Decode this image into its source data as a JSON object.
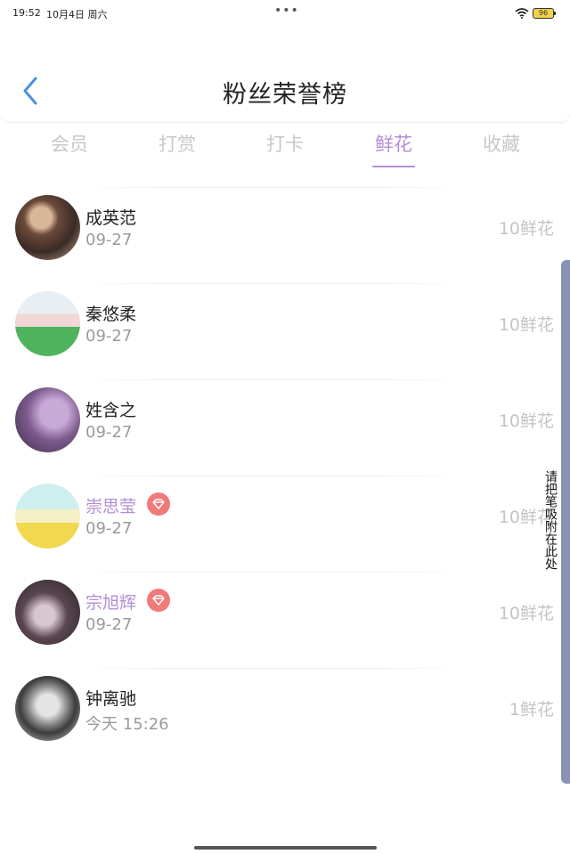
{
  "status_bar": {
    "time": "19:52",
    "date": "10月4日 周六",
    "dots": "•••",
    "battery": "96"
  },
  "header": {
    "title": "粉丝荣誉榜",
    "back_icon": "chevron-left-icon",
    "accent_color": "#4a90e2"
  },
  "tabs": [
    {
      "label": "会员",
      "active": false
    },
    {
      "label": "打赏",
      "active": false
    },
    {
      "label": "打卡",
      "active": false
    },
    {
      "label": "鲜花",
      "active": true
    },
    {
      "label": "收藏",
      "active": false
    }
  ],
  "active_color": "#b48ed8",
  "rows": [
    {
      "name": "成英范",
      "date": "09-27",
      "value": "10鲜花",
      "vip": false
    },
    {
      "name": "秦悠柔",
      "date": "09-27",
      "value": "10鲜花",
      "vip": false
    },
    {
      "name": "姓含之",
      "date": "09-27",
      "value": "10鲜花",
      "vip": false
    },
    {
      "name": "崇思莹",
      "date": "09-27",
      "value": "10鲜花",
      "vip": true
    },
    {
      "name": "宗旭辉",
      "date": "09-27",
      "value": "10鲜花",
      "vip": true
    },
    {
      "name": "钟离驰",
      "date": "今天 15:26",
      "value": "1鲜花",
      "vip": false
    }
  ],
  "side_dock": {
    "text": "请把笔吸附在此处"
  }
}
